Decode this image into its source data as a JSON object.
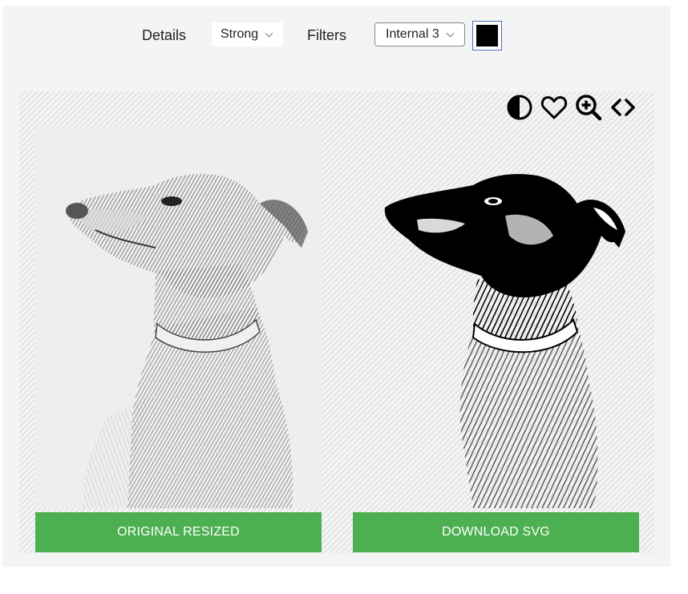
{
  "toolbar": {
    "details_label": "Details",
    "details_value": "Strong",
    "filters_label": "Filters",
    "filters_value": "Internal 3",
    "color_value": "#000000"
  },
  "stage_icons": [
    "contrast-icon",
    "heart-icon",
    "zoom-in-icon",
    "code-icon"
  ],
  "panels": {
    "left_button": "ORIGINAL RESIZED",
    "right_button": "DOWNLOAD SVG"
  },
  "colors": {
    "button_green": "#4caf50",
    "panel_bg": "#f4f4f4"
  }
}
